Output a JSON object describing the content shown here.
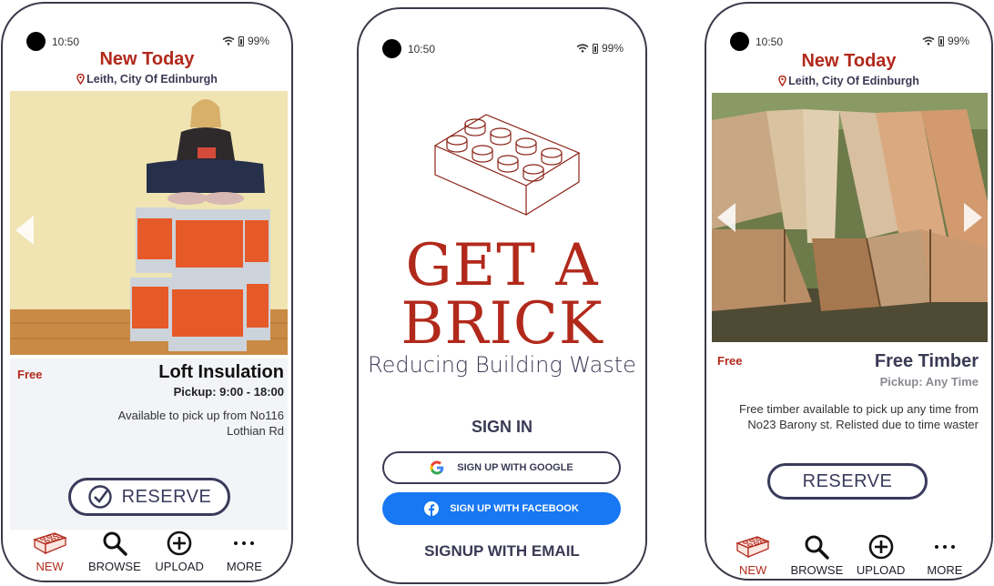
{
  "status": {
    "time": "10:50",
    "battery": "99%"
  },
  "header": {
    "title": "New Today",
    "location": "Leith, City Of Edinburgh"
  },
  "listing1": {
    "price": "Free",
    "title": "Loft Insulation",
    "pickup": "Pickup: 9:00 - 18:00",
    "description": "Available to pick up from No116 Lothian Rd",
    "reserve_label": "RESERVE"
  },
  "listing2": {
    "price": "Free",
    "title": "Free Timber",
    "pickup": "Pickup: Any Time",
    "description": "Free timber available to pick up any time from No23 Barony st. Relisted due to time waster",
    "reserve_label": "RESERVE"
  },
  "nav": {
    "items": [
      {
        "label": "NEW",
        "icon": "brick-icon",
        "active": true
      },
      {
        "label": "BROWSE",
        "icon": "search-icon"
      },
      {
        "label": "UPLOAD",
        "icon": "plus-circle-icon"
      },
      {
        "label": "MORE",
        "icon": "more-icon"
      }
    ]
  },
  "signin_screen": {
    "brand_line1": "GET A",
    "brand_line2": "BRICK",
    "tagline": "Reducing Building Waste",
    "sign_in": "SIGN IN",
    "google": "SIGN UP WITH GOOGLE",
    "facebook": "SIGN UP WITH FACEBOOK",
    "email": "SIGNUP WITH  EMAIL"
  },
  "colors": {
    "brand": "#b1291b",
    "navy": "#3a3a55",
    "facebook": "#1877f2"
  }
}
